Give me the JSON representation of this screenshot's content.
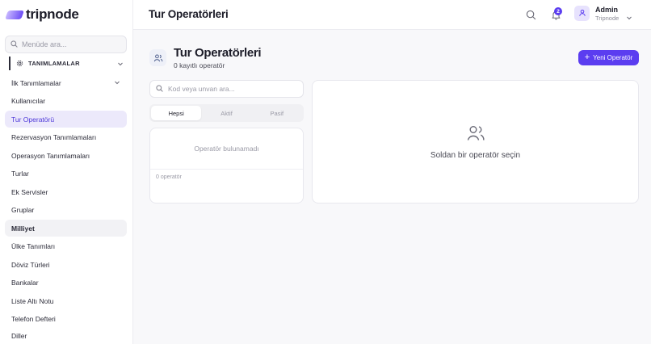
{
  "brand": {
    "name": "tripnode"
  },
  "sidebar": {
    "search_placeholder": "Menüde ara...",
    "section_label": "TANIMLAMALAR",
    "items": [
      {
        "label": "İlk Tanımlamalar",
        "has_chevron": true
      },
      {
        "label": "Kullanıcılar"
      },
      {
        "label": "Tur Operatörü",
        "active": true
      },
      {
        "label": "Rezervasyon Tanımlamaları"
      },
      {
        "label": "Operasyon Tanımlamaları"
      },
      {
        "label": "Turlar"
      },
      {
        "label": "Ek Servisler"
      },
      {
        "label": "Gruplar"
      },
      {
        "label": "Milliyet",
        "hovered": true
      },
      {
        "label": "Ülke Tanımları"
      },
      {
        "label": "Döviz Türleri"
      },
      {
        "label": "Bankalar"
      },
      {
        "label": "Liste Altı Notu"
      },
      {
        "label": "Telefon Defteri"
      },
      {
        "label": "Diller"
      }
    ]
  },
  "header": {
    "title": "Tur Operatörleri",
    "notification_count": "2",
    "user": {
      "name": "Admin",
      "org": "Tripnode"
    }
  },
  "main": {
    "title": "Tur Operatörleri",
    "subtitle": "0 kayıtlı operatör",
    "new_button_label": "Yeni Operatör",
    "search_placeholder": "Kod veya unvan ara...",
    "filters": [
      "Hepsi",
      "Aktif",
      "Pasif"
    ],
    "active_filter": "Hepsi",
    "empty_list_text": "Operatör bulunamadı",
    "list_count": "0 operatör",
    "detail_empty_text": "Soldan bir operatör seçin"
  },
  "colors": {
    "accent": "#5b3df0",
    "active_bg": "#ece9fb"
  },
  "icons": {
    "search": "search-icon",
    "section": "gear-icon",
    "chevron": "chevron-down-icon",
    "notifications": "bell-icon",
    "avatar": "user-icon",
    "page": "users-icon",
    "add": "plus-icon"
  }
}
